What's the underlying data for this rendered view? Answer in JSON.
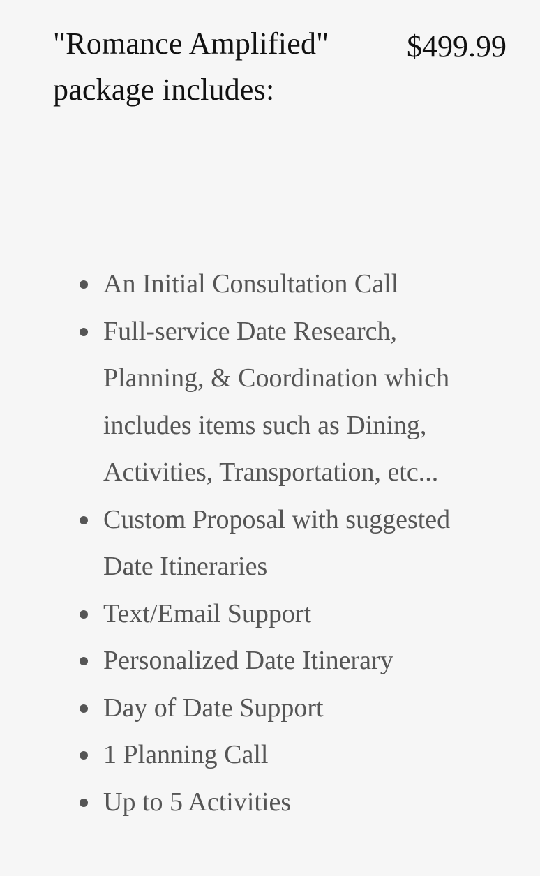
{
  "package": {
    "title": "\"Romance Amplified\" package includes:",
    "price": "$499.99"
  },
  "features": [
    "An Initial Consultation Call",
    "Full-service Date Research, Planning, & Coordination which includes items such as Dining, Activities, Transportation, etc...",
    "Custom Proposal with suggested Date Itineraries",
    "Text/Email Support",
    "Personalized Date Itinerary",
    "Day of Date Support",
    "1 Planning Call",
    "Up to 5 Activities"
  ],
  "icons": {
    "bullet": "bullet-icon"
  },
  "colors": {
    "background": "#f6f6f6",
    "title": "#111111",
    "body": "#555555"
  }
}
